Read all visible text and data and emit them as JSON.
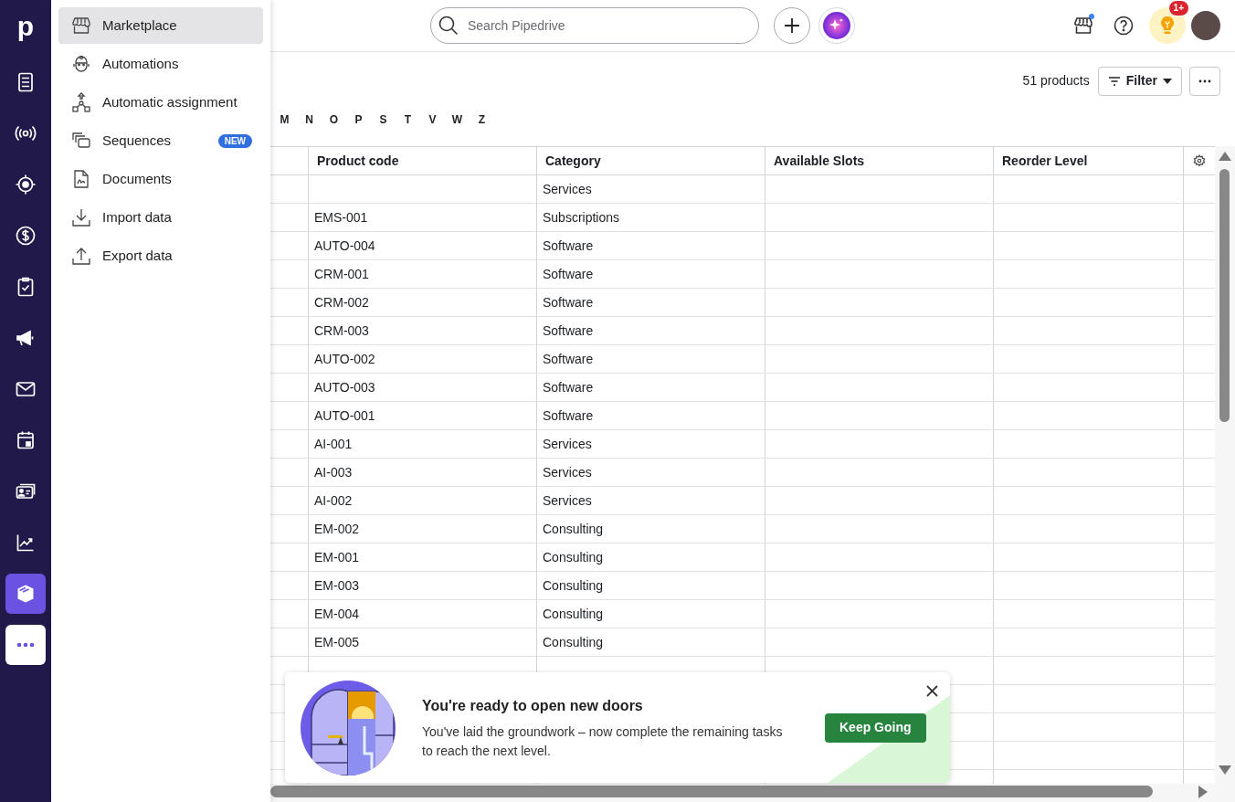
{
  "rail": {
    "logo": "p",
    "items": [
      {
        "kind": "nav",
        "selected": false
      },
      {
        "kind": "nav",
        "selected": false
      },
      {
        "kind": "nav",
        "selected": false
      },
      {
        "kind": "nav",
        "selected": false
      },
      {
        "kind": "nav",
        "selected": false
      },
      {
        "kind": "nav",
        "selected": false
      },
      {
        "kind": "nav",
        "selected": false
      },
      {
        "kind": "nav",
        "selected": false
      },
      {
        "kind": "nav",
        "selected": false
      },
      {
        "kind": "nav",
        "selected": false
      },
      {
        "kind": "nav",
        "selected": true
      },
      {
        "kind": "more"
      }
    ]
  },
  "menu": [
    {
      "label": "Marketplace",
      "selected": true
    },
    {
      "label": "Automations",
      "selected": false
    },
    {
      "label": "Automatic assignment",
      "selected": false
    },
    {
      "label": "Sequences",
      "selected": false,
      "badge": "NEW"
    },
    {
      "label": "Documents",
      "selected": false
    },
    {
      "label": "Import data",
      "selected": false
    },
    {
      "label": "Export data",
      "selected": false
    }
  ],
  "topbar": {
    "search": {
      "placeholder": "Search Pipedrive"
    },
    "notification_count": "1+"
  },
  "toolbar": {
    "count": "51 products",
    "filter": "Filter"
  },
  "alphabet": [
    "M",
    "N",
    "O",
    "P",
    "S",
    "T",
    "V",
    "W",
    "Z"
  ],
  "table": {
    "columns": [
      "Product code",
      "Category",
      "Available Slots",
      "Reorder Level"
    ],
    "rows": [
      {
        "code": "",
        "category": "Services"
      },
      {
        "code": "EMS-001",
        "category": "Subscriptions"
      },
      {
        "code": "AUTO-004",
        "category": "Software"
      },
      {
        "code": "CRM-001",
        "category": "Software"
      },
      {
        "code": "CRM-002",
        "category": "Software"
      },
      {
        "code": "CRM-003",
        "category": "Software"
      },
      {
        "code": "AUTO-002",
        "category": "Software"
      },
      {
        "code": "AUTO-003",
        "category": "Software"
      },
      {
        "code": "AUTO-001",
        "category": "Software"
      },
      {
        "code": "AI-001",
        "category": "Services"
      },
      {
        "code": "AI-003",
        "category": "Services"
      },
      {
        "code": "AI-002",
        "category": "Services"
      },
      {
        "code": "EM-002",
        "category": "Consulting"
      },
      {
        "code": "EM-001",
        "category": "Consulting"
      },
      {
        "code": "EM-003",
        "category": "Consulting"
      },
      {
        "code": "EM-004",
        "category": "Consulting"
      },
      {
        "code": "EM-005",
        "category": "Consulting"
      }
    ]
  },
  "toast": {
    "title": "You're ready to open new doors",
    "text": "You've laid the groundwork – now complete the remaining tasks to reach the next level.",
    "button": "Keep Going"
  }
}
